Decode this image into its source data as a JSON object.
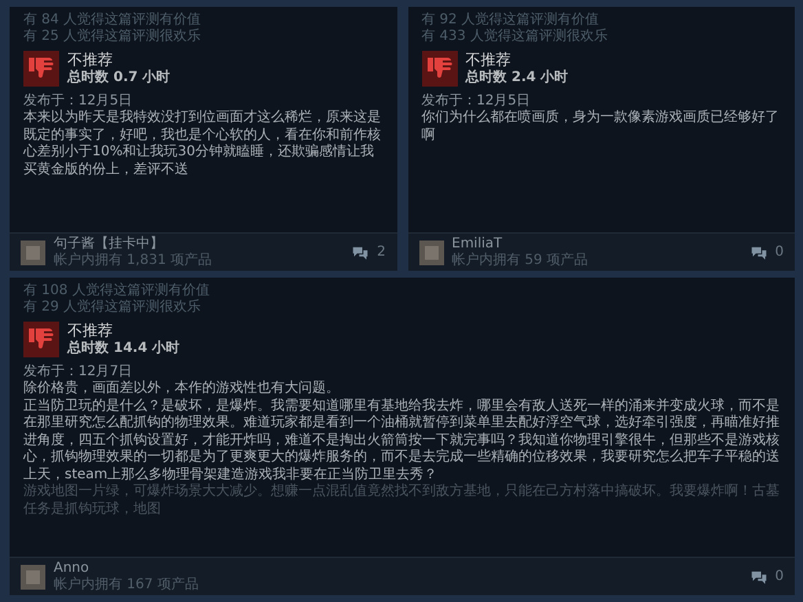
{
  "reviews": [
    {
      "helpful": "有 84 人觉得这篇评测有价值",
      "funny": "有 25 人觉得这篇评测很欢乐",
      "recommended": false,
      "verdict": "不推荐",
      "playtime": "总时数 0.7 小时",
      "posted": "发布于：12月5日",
      "paragraphs": [
        {
          "text": "本来以为昨天是我特效没打到位画面才这么稀烂，原来这是既定的事实了，好吧，我也是个心软的人，看在你和前作核心差别小于10%和让我玩30分钟就瞌睡，还欺骗感情让我买黄金版的份上，差评不送",
          "faded": false
        }
      ],
      "author": "句子酱【挂卡中】",
      "products": "帐户内拥有 1,831 项产品",
      "comments": "2"
    },
    {
      "helpful": "有 92 人觉得这篇评测有价值",
      "funny": "有 433 人觉得这篇评测很欢乐",
      "recommended": false,
      "verdict": "不推荐",
      "playtime": "总时数 2.4 小时",
      "posted": "发布于：12月5日",
      "paragraphs": [
        {
          "text": "你们为什么都在喷画质，身为一款像素游戏画质已经够好了啊",
          "faded": false
        }
      ],
      "author": "EmiliaT",
      "products": "帐户内拥有 59 项产品",
      "comments": "0"
    },
    {
      "helpful": "有 108 人觉得这篇评测有价值",
      "funny": "有 29 人觉得这篇评测很欢乐",
      "recommended": false,
      "verdict": "不推荐",
      "playtime": "总时数 14.4 小时",
      "posted": "发布于：12月7日",
      "paragraphs": [
        {
          "text": "除价格贵，画面差以外，本作的游戏性也有大问题。",
          "faded": false
        },
        {
          "text": "正当防卫玩的是什么？是破坏，是爆炸。我需要知道哪里有基地给我去炸，哪里会有敌人送死一样的涌来并变成火球，而不是在那里研究怎么配抓钩的物理效果。难道玩家都是看到一个油桶就暂停到菜单里去配好浮空气球，选好牵引强度，再瞄准好推进角度，四五个抓钩设置好，才能开炸吗，难道不是掏出火箭筒按一下就完事吗？我知道你物理引擎很牛，但那些不是游戏核心，抓钩物理效果的一切都是为了更爽更大的爆炸服务的，而不是去完成一些精确的位移效果，我要研究怎么把车子平稳的送上天，steam上那么多物理骨架建造游戏我非要在正当防卫里去秀？",
          "faded": false
        },
        {
          "text": "游戏地图一片绿，可爆炸场景大大减少。想赚一点混乱值竟然找不到敌方基地，只能在己方村落中搞破坏。我要爆炸啊！古墓任务是抓钩玩球，地图",
          "faded": true
        }
      ],
      "author": "Anno",
      "products": "帐户内拥有 167 项产品",
      "comments": "0"
    }
  ]
}
